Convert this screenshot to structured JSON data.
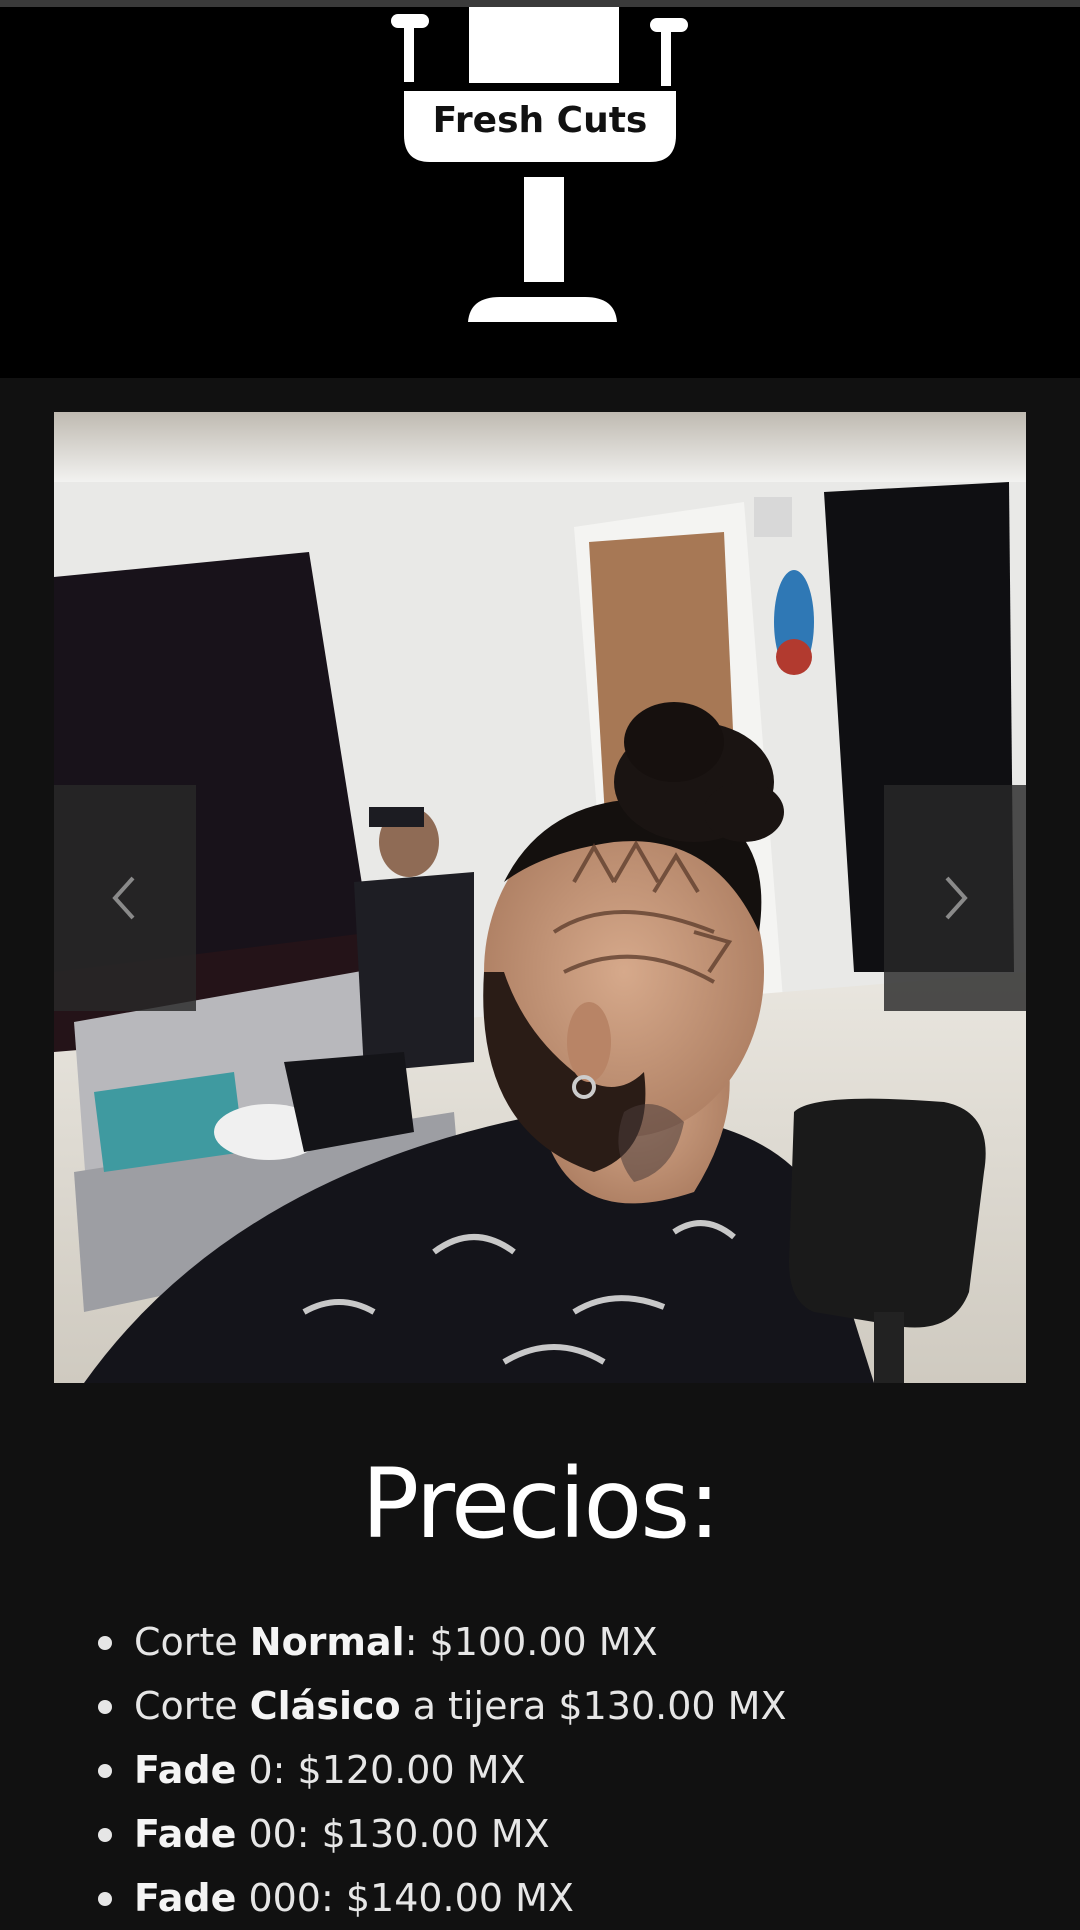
{
  "header": {
    "logo_text": "Fresh Cuts",
    "logo_icon": "barber-chair-icon"
  },
  "carousel": {
    "image_alt": "Hombre con moño de rastas y diseño de mandala rapado en el costado de la cabeza, sentado en silla de barbero",
    "prev_icon": "chevron-left-icon",
    "next_icon": "chevron-right-icon"
  },
  "prices": {
    "title": "Precios:",
    "items": [
      {
        "pre": "Corte ",
        "bold": "Normal",
        "post": ": $100.00 MX"
      },
      {
        "pre": "Corte ",
        "bold": "Clásico",
        "post": " a tijera $130.00 MX"
      },
      {
        "pre": "",
        "bold": "Fade",
        "post": " 0: $120.00 MX"
      },
      {
        "pre": "",
        "bold": "Fade",
        "post": " 00: $130.00 MX"
      },
      {
        "pre": "",
        "bold": "Fade",
        "post": " 000: $140.00 MX"
      }
    ]
  },
  "colors": {
    "header_bg": "#000000",
    "page_bg": "#111111",
    "text": "#e6e6e6",
    "title": "#ffffff"
  }
}
